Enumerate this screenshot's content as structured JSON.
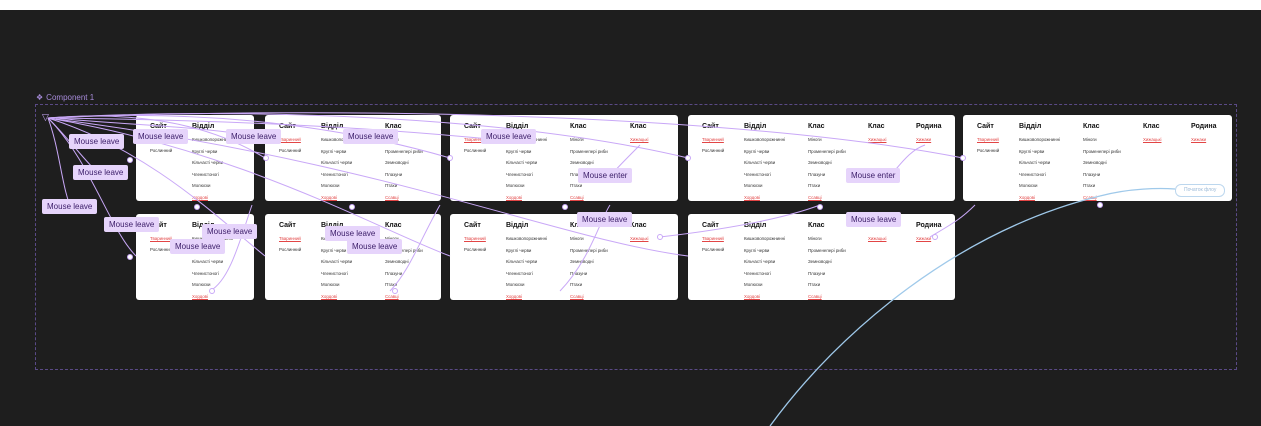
{
  "component": {
    "label": "Component 1",
    "icon": "component-diamond-icon"
  },
  "headers": {
    "site": "Сайт",
    "dept": "Відділ",
    "class": "Клас",
    "family": "Родина"
  },
  "items": {
    "site": [
      "Тваринний",
      "Рослинний"
    ],
    "dept": [
      "Кишковопорожнинні",
      "Круглі черви",
      "Кільчасті черви",
      "Членистоногі",
      "Молюски",
      "Хордові"
    ],
    "class": [
      "Міноги",
      "Променепері риби",
      "Земноводні",
      "Плазуни",
      "Птахи",
      "Ссавці"
    ],
    "class2": "Хижацькі",
    "family": "Хижаки"
  },
  "interactions": {
    "leave": "Mouse leave",
    "enter": "Mouse enter"
  },
  "prototype": {
    "start_label": "Початок флоу"
  },
  "colors": {
    "wire": "#c9a8f7",
    "flow": "#9fc9ea",
    "link": "#e24545",
    "tag_bg": "#e6d4fb"
  }
}
